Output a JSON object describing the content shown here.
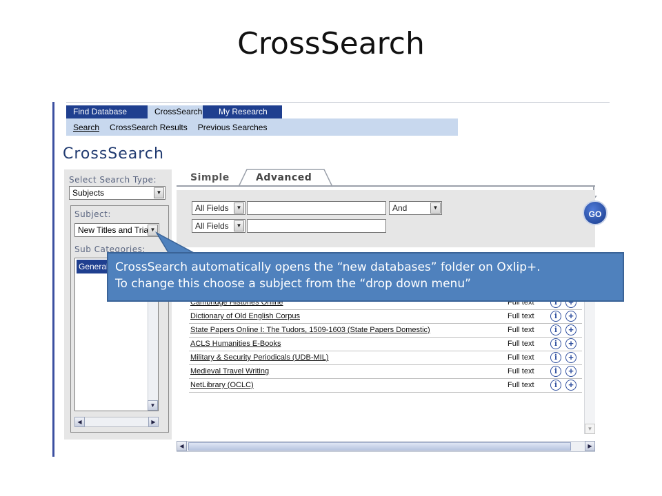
{
  "slide": {
    "title": "CrossSearch"
  },
  "nav": {
    "tabs": [
      {
        "label": "Find Database"
      },
      {
        "label": "CrossSearch"
      },
      {
        "label": "My Research"
      }
    ],
    "subnav": [
      {
        "label": "Search"
      },
      {
        "label": "CrossSearch Results"
      },
      {
        "label": "Previous Searches"
      }
    ]
  },
  "page": {
    "heading": "CrossSearch"
  },
  "left_panel": {
    "search_type_label": "Select Search Type:",
    "search_type_value": "Subjects",
    "subject_label": "Subject:",
    "subject_value": "New Titles and Trials",
    "subcategories_label": "Sub Categories:",
    "subcategory_selected": "General"
  },
  "search_tabs": {
    "simple": "Simple",
    "advanced": "Advanced"
  },
  "form": {
    "field1": "All Fields",
    "operator": "And",
    "field2": "All Fields",
    "go_label": "GO"
  },
  "results": [
    {
      "title": "Cambridge Histories Online",
      "access": "Full text"
    },
    {
      "title": "Dictionary of Old English Corpus",
      "access": "Full text"
    },
    {
      "title": "State Papers Online I: The Tudors, 1509-1603 (State Papers Domestic)",
      "access": "Full text"
    },
    {
      "title": "ACLS Humanities E-Books",
      "access": "Full text"
    },
    {
      "title": "Military & Security Periodicals (UDB-MIL)",
      "access": "Full text"
    },
    {
      "title": "Medieval Travel Writing",
      "access": "Full text"
    },
    {
      "title": "NetLibrary (OCLC)",
      "access": "Full text"
    }
  ],
  "callout": {
    "line1": "CrossSearch automatically opens the “new databases” folder on Oxlip+.",
    "line2": "To change this choose a subject from the “drop down menu”"
  },
  "icons": {
    "dropdown": "chevron-down-icon",
    "info": "info-icon",
    "add": "plus-icon",
    "go": "go-icon"
  },
  "colors": {
    "nav_blue": "#1f3f8f",
    "subnav": "#c8d8ee",
    "callout": "#4f81bd",
    "heading": "#203a70"
  }
}
